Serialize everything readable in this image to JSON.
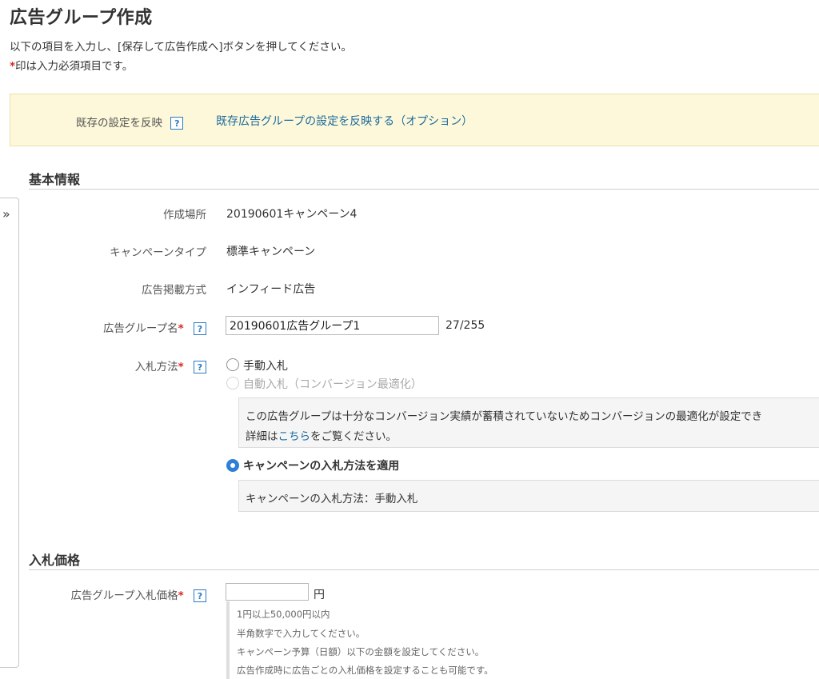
{
  "header": {
    "title": "広告グループ作成",
    "intro": "以下の項目を入力し、[保存して広告作成へ]ボタンを押してください。",
    "required_mark": "*",
    "required_note": "印は入力必須項目です。"
  },
  "banner": {
    "label": "既存の設定を反映",
    "help": "?",
    "link": "既存広告グループの設定を反映する（オプション）"
  },
  "sidebar": {
    "toggle_icon": "»"
  },
  "basic_info": {
    "title": "基本情報",
    "location": {
      "label": "作成場所",
      "value": "20190601キャンペーン4"
    },
    "campaign_type": {
      "label": "キャンペーンタイプ",
      "value": "標準キャンペーン"
    },
    "ad_format": {
      "label": "広告掲載方式",
      "value": "インフィード広告"
    },
    "ad_group_name": {
      "label": "広告グループ名",
      "required": "*",
      "help": "?",
      "value": "20190601広告グループ1",
      "count": "27/255"
    },
    "bid_method": {
      "label": "入札方法",
      "required": "*",
      "help": "?",
      "options": [
        {
          "label": "手動入札",
          "state": "unchecked"
        },
        {
          "label": "自動入札（コンバージョン最適化）",
          "state": "disabled"
        },
        {
          "label": "キャンペーンの入札方法を適用",
          "state": "checked"
        }
      ],
      "notice_line1": "この広告グループは十分なコンバージョン実績が蓄積されていないためコンバージョンの最適化が設定でき",
      "notice_line2_prefix": "詳細は",
      "notice_link": "こちら",
      "notice_line2_suffix": "をご覧ください。",
      "campaign_bid_info": "キャンペーンの入札方法：手動入札"
    }
  },
  "bid_price": {
    "title": "入札価格",
    "label": "広告グループ入札価格",
    "required": "*",
    "help": "?",
    "value": "",
    "unit": "円",
    "hints": [
      "1円以上50,000円以内",
      "半角数字で入力してください。",
      "キャンペーン予算（日額）以下の金額を設定してください。",
      "広告作成時に広告ごとの入札価格を設定することも可能です。"
    ]
  },
  "colors": {
    "accent_link": "#1a6aa0",
    "required": "#d9261c",
    "banner_bg": "#fdf8d9",
    "radio_checked": "#2f7fd8"
  }
}
